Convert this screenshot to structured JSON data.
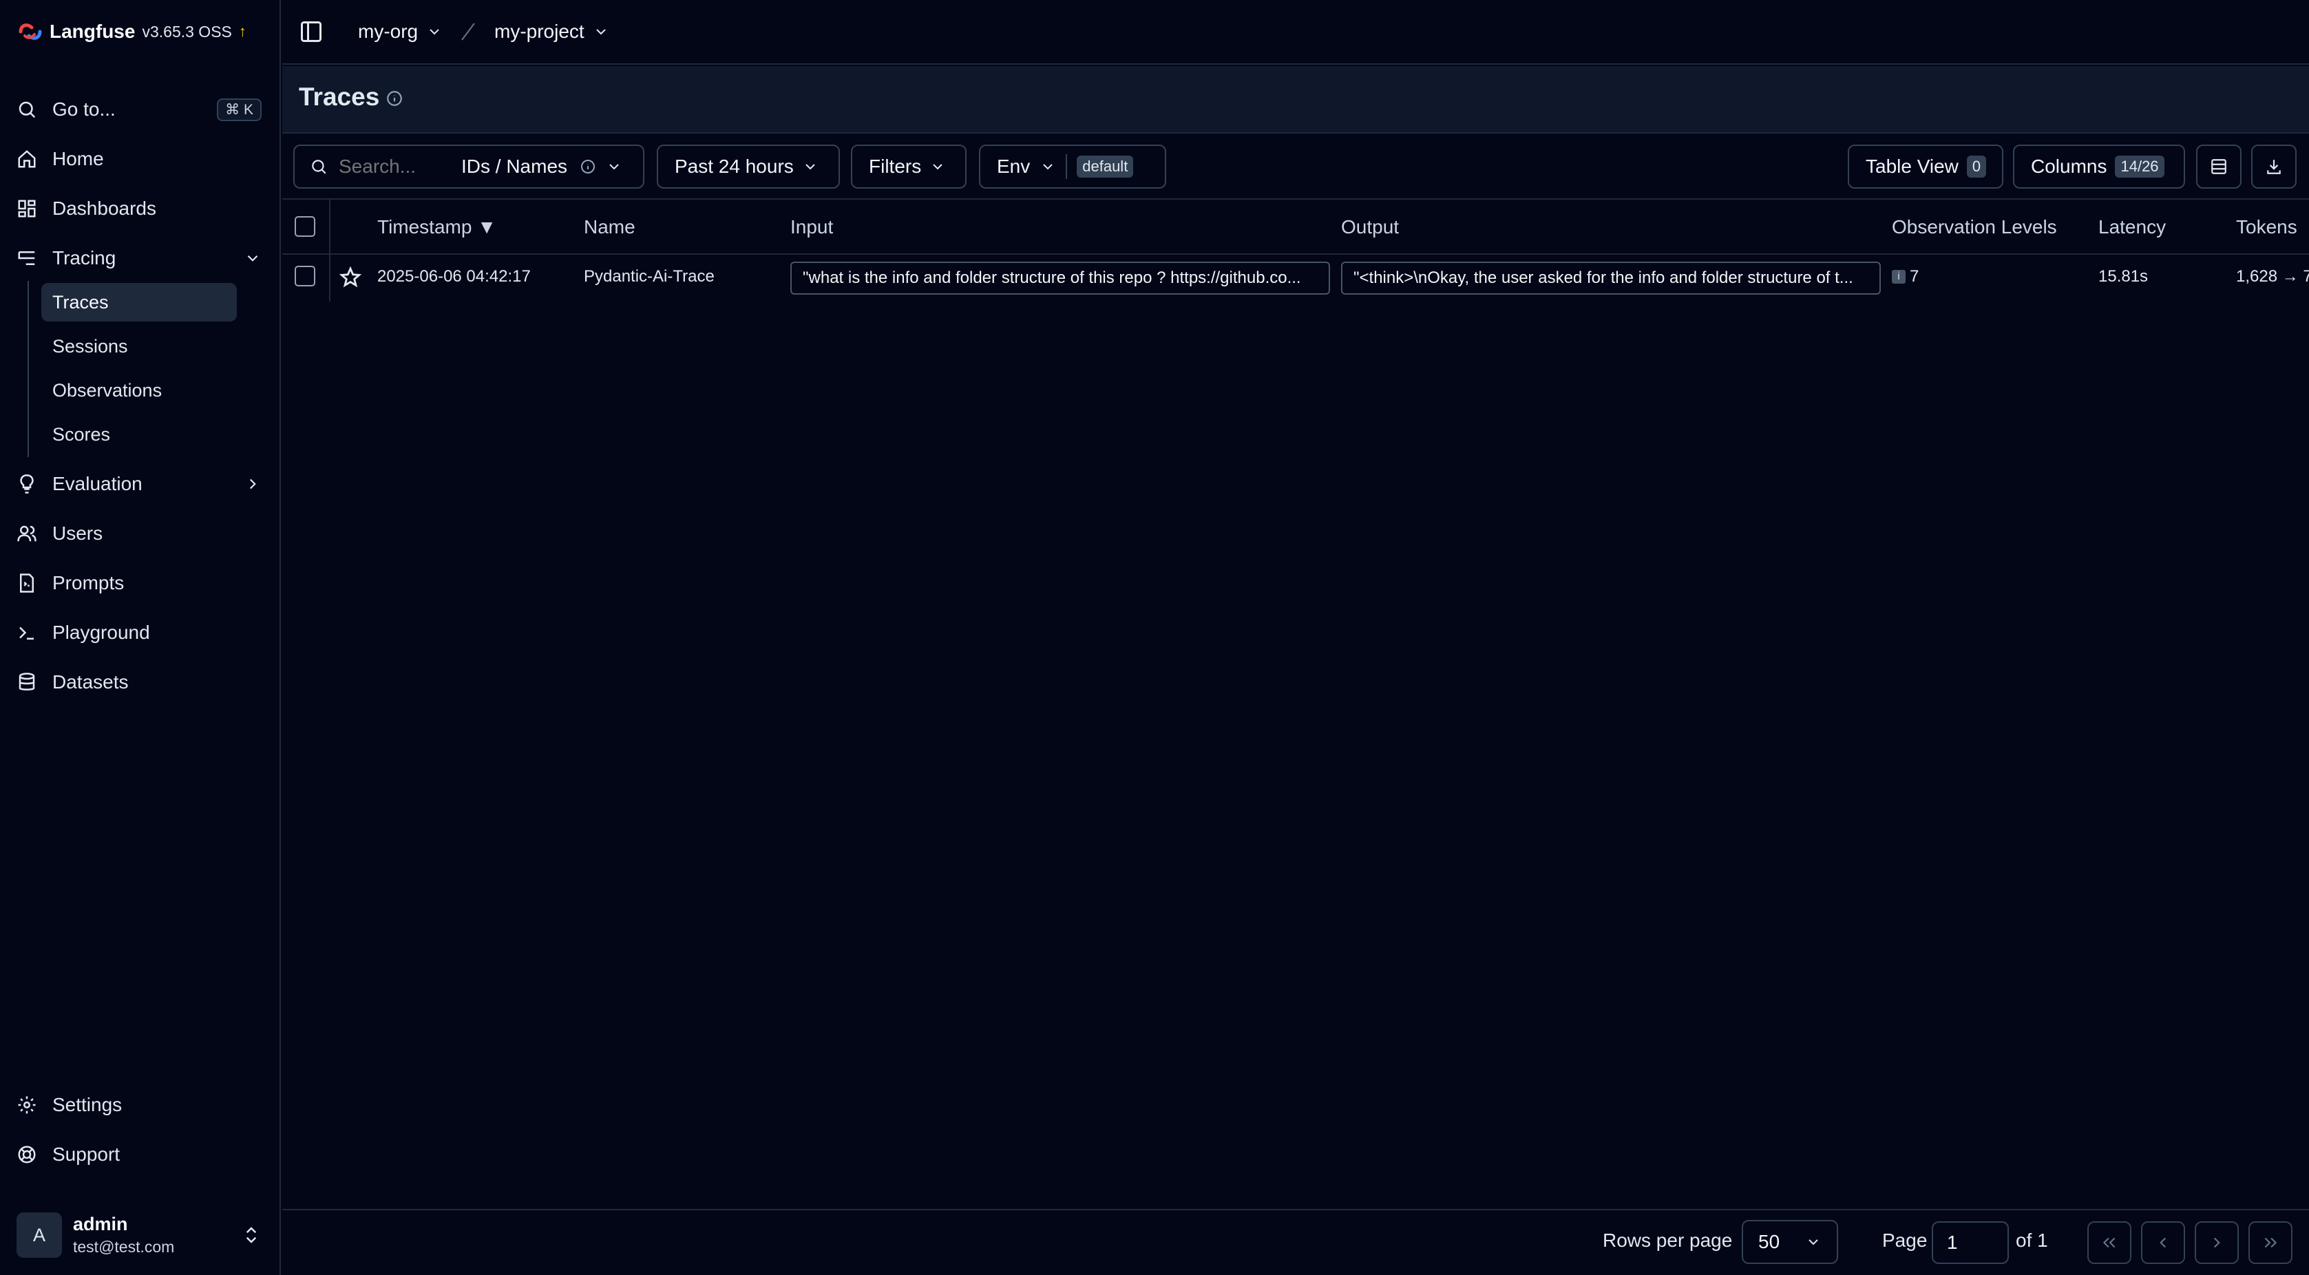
{
  "brand": {
    "name": "Langfuse",
    "version": "v3.65.3 OSS",
    "update_arrow": "↑"
  },
  "sidebar": {
    "goto": {
      "label": "Go to...",
      "shortcut": "⌘ K"
    },
    "items": [
      {
        "label": "Home",
        "icon": "home-icon"
      },
      {
        "label": "Dashboards",
        "icon": "dashboard-icon"
      },
      {
        "label": "Tracing",
        "icon": "tracing-icon"
      }
    ],
    "tracing_sub": [
      "Traces",
      "Sessions",
      "Observations",
      "Scores"
    ],
    "items_after": [
      {
        "label": "Evaluation",
        "icon": "lightbulb-icon"
      },
      {
        "label": "Users",
        "icon": "users-icon"
      },
      {
        "label": "Prompts",
        "icon": "prompt-file-icon"
      },
      {
        "label": "Playground",
        "icon": "terminal-icon"
      },
      {
        "label": "Datasets",
        "icon": "database-icon"
      }
    ],
    "bottom": [
      {
        "label": "Settings",
        "icon": "gear-icon"
      },
      {
        "label": "Support",
        "icon": "support-icon"
      }
    ],
    "user": {
      "initial": "A",
      "name": "admin",
      "email": "test@test.com"
    }
  },
  "breadcrumb": {
    "org": "my-org",
    "project": "my-project"
  },
  "page": {
    "title": "Traces"
  },
  "toolbar": {
    "search_placeholder": "Search...",
    "search_mode": "IDs / Names",
    "time_range": "Past 24 hours",
    "filters": "Filters",
    "env_label": "Env",
    "env_value": "default",
    "table_view": "Table View",
    "table_view_count": "0",
    "columns": "Columns",
    "columns_count": "14/26"
  },
  "table": {
    "headers": {
      "timestamp": "Timestamp ▼",
      "name": "Name",
      "input": "Input",
      "output": "Output",
      "obs_levels": "Observation Levels",
      "latency": "Latency",
      "tokens": "Tokens"
    },
    "rows": [
      {
        "timestamp": "2025-06-06 04:42:17",
        "name": "Pydantic-Ai-Trace",
        "input": "\"what is the info and folder structure of this repo ? https://github.co...",
        "output": "\"<think>\\nOkay, the user asked for the info and folder structure of t...",
        "obs_level_mark": "i",
        "obs_level_count": "7",
        "latency": "15.81s",
        "tokens": "1,628 → 7"
      }
    ]
  },
  "footer": {
    "rows_per_page_label": "Rows per page",
    "rows_per_page": "50",
    "page_label": "Page",
    "page_value": "1",
    "page_of": "of 1"
  }
}
